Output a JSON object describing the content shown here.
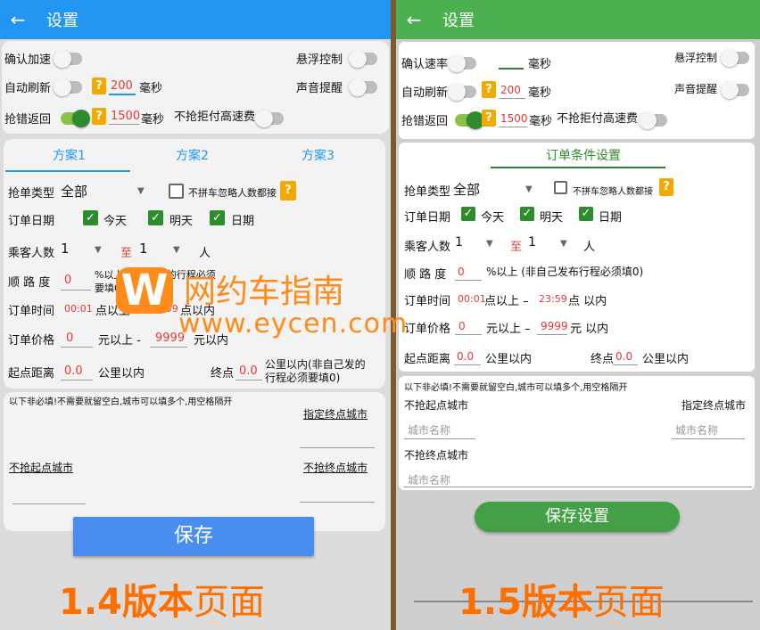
{
  "left": {
    "title": "设置",
    "toggles": {
      "confirm_accel": "确认加速",
      "auto_refresh": "自动刷新",
      "grab_error_return": "抢错返回",
      "float_control": "悬浮控制",
      "sound_alert": "声音提醒",
      "no_grab_highspeed": "不抢拒付高速费"
    },
    "refresh_ms": "200",
    "return_ms": "1500",
    "ms_unit": "毫秒",
    "tabs": [
      "方案1",
      "方案2",
      "方案3"
    ],
    "order_type_label": "抢单类型",
    "order_type_value": "全部",
    "ignore_count_label": "不拼车忽略人数都接",
    "order_date_label": "订单日期",
    "today": "今天",
    "tomorrow": "明天",
    "date": "日期",
    "passenger_label": "乘客人数",
    "passenger_from": "1",
    "to_label": "至",
    "passenger_to": "1",
    "person_unit": "人",
    "route_label": "顺 路 度",
    "route_value": "0",
    "route_note_1": "%以上(非自己发的行程必须",
    "route_note_2": "要填0)",
    "order_time_label": "订单时间",
    "time_from": "00:01",
    "time_from_suffix": "点以上 -",
    "time_to": "23:59",
    "time_to_suffix": "点以内",
    "price_label": "订单价格",
    "price_from": "0",
    "price_from_suffix": "元以上 -",
    "price_to": "9999",
    "price_to_suffix": "元以内",
    "start_dist_label": "起点距离",
    "start_dist_value": "0.0",
    "km_within": "公里以内",
    "end_label": "终点",
    "end_value": "0.0",
    "end_note_1": "公里以内(非自己发的",
    "end_note_2": "行程必须要填0)",
    "optional_note": "以下非必填!不需要就留空白,城市可以填多个,用空格隔开",
    "dest_city": "指定终点城市",
    "no_start_city": "不抢起点城市",
    "no_end_city": "不抢终点城市",
    "save": "保存",
    "caption_num": "1.4版本",
    "caption_text": "页面"
  },
  "right": {
    "title": "设置",
    "toggles": {
      "confirm_rate": "确认速率",
      "auto_refresh": "自动刷新",
      "grab_error_return": "抢错返回",
      "float_control": "悬浮控制",
      "sound_alert": "声音提醒",
      "no_grab_highspeed": "不抢拒付高速费"
    },
    "rate_value": "",
    "refresh_ms": "200",
    "return_ms": "1500",
    "ms_unit": "毫秒",
    "section_title": "订单条件设置",
    "order_type_label": "抢单类型",
    "order_type_value": "全部",
    "ignore_count_label": "不拼车忽略人数都接",
    "order_date_label": "订单日期",
    "today": "今天",
    "tomorrow": "明天",
    "date": "日期",
    "passenger_label": "乘客人数",
    "passenger_from": "1",
    "to_label": "至",
    "passenger_to": "1",
    "person_unit": "人",
    "route_label": "顺 路 度",
    "route_value": "0",
    "route_note": "%以上 (非自己发布行程必须填0)",
    "order_time_label": "订单时间",
    "time_from": "00:01",
    "time_from_suffix": "点以上 –",
    "time_to": "23:59",
    "time_to_suffix": "点 以内",
    "price_label": "订单价格",
    "price_from": "0",
    "price_from_suffix": "元以上 –",
    "price_to": "9999",
    "price_to_suffix": "元 以内",
    "start_dist_label": "起点距离",
    "start_dist_value": "0.0",
    "km_within": "公里以内",
    "end_label": "终点",
    "end_value": "0.0",
    "optional_note": "以下非必填!不需要就留空白,城市可以填多个,用空格隔开",
    "no_start_city": "不抢起点城市",
    "dest_city": "指定终点城市",
    "no_end_city": "不抢终点城市",
    "city_placeholder": "城市名称",
    "save": "保存设置",
    "caption_num": "1.5版本",
    "caption_text": "页面"
  },
  "watermark": {
    "brand": "网约车指南",
    "url": "www.eycen.com"
  },
  "colors": {
    "left_bar": "#2196f3",
    "right_bar": "#4caf50",
    "caption": "#ff6f00",
    "accent_green": "#2e8b2e"
  }
}
